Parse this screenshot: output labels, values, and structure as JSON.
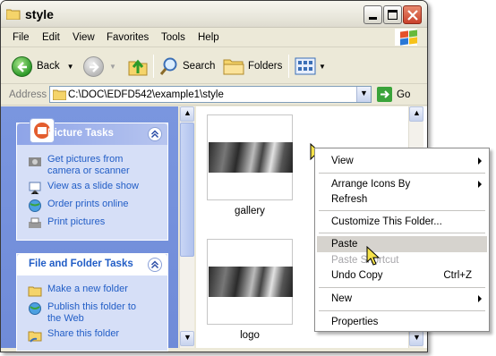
{
  "window": {
    "title": "style",
    "buttons": {
      "minimize": "minimize",
      "maximize": "maximize",
      "close": "close"
    }
  },
  "menubar": {
    "items": [
      "File",
      "Edit",
      "View",
      "Favorites",
      "Tools",
      "Help"
    ]
  },
  "toolbar": {
    "back": "Back",
    "search": "Search",
    "folders": "Folders"
  },
  "address": {
    "label": "Address",
    "path": "C:\\DOC\\EDFD542\\example1\\style",
    "go": "Go"
  },
  "taskpane": {
    "picture_tasks": {
      "title": "Picture Tasks",
      "items": [
        "Get pictures from camera or scanner",
        "View as a slide show",
        "Order prints online",
        "Print pictures"
      ]
    },
    "file_tasks": {
      "title": "File and Folder Tasks",
      "items": [
        "Make a new folder",
        "Publish this folder to the Web",
        "Share this folder"
      ]
    }
  },
  "files": [
    {
      "name": "gallery"
    },
    {
      "name": "logo"
    }
  ],
  "context_menu": {
    "items": [
      {
        "label": "View",
        "submenu": true
      },
      {
        "label": "Arrange Icons By",
        "submenu": true
      },
      {
        "label": "Refresh"
      },
      {
        "label": "Customize This Folder..."
      },
      {
        "label": "Paste",
        "highlighted": true
      },
      {
        "label": "Paste Shortcut",
        "disabled": true
      },
      {
        "label": "Undo Copy",
        "shortcut": "Ctrl+Z"
      },
      {
        "label": "New",
        "submenu": true
      },
      {
        "label": "Properties"
      }
    ]
  },
  "colors": {
    "taskpane_bg": "#6f8bd8",
    "link": "#215dc6",
    "highlight": "#d6d3ce"
  }
}
